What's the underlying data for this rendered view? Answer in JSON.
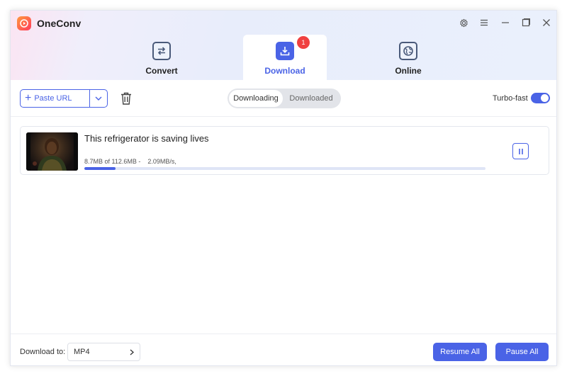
{
  "app": {
    "title": "OneConv"
  },
  "colors": {
    "accent": "#4a63e6",
    "badge": "#f04040"
  },
  "window_controls": [
    "settings-icon",
    "menu-icon",
    "minimize-icon",
    "maximize-icon",
    "close-icon"
  ],
  "tabs": [
    {
      "label": "Convert",
      "icon": "convert-icon"
    },
    {
      "label": "Download",
      "icon": "download-icon",
      "badge": "1",
      "active": true
    },
    {
      "label": "Online",
      "icon": "globe-icon"
    }
  ],
  "toolbar": {
    "paste_url_label": "Paste URL",
    "segments": [
      "Downloading",
      "Downloaded"
    ],
    "active_segment": "Downloading",
    "turbo_label": "Turbo-fast",
    "turbo_on": true
  },
  "downloads": [
    {
      "title": "This refrigerator is saving lives",
      "progress_text": "8.7MB of 112.6MB -    2.09MB/s,",
      "progress": 0.077
    }
  ],
  "footer": {
    "download_to_label": "Download to:",
    "format_value": "MP4",
    "resume_all_label": "Resume All",
    "pause_all_label": "Pause All"
  }
}
